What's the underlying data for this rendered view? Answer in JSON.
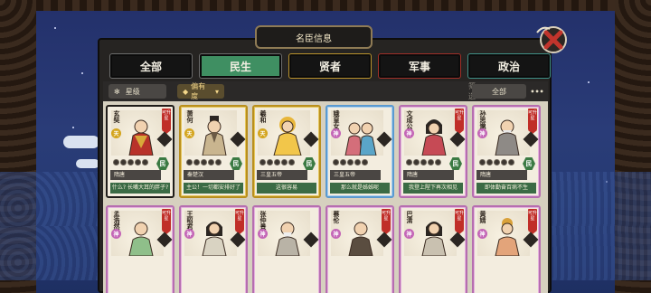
{
  "header": {
    "title": "名臣信息"
  },
  "tabs": [
    {
      "label": "全部"
    },
    {
      "label": "民生"
    },
    {
      "label": "贤者"
    },
    {
      "label": "军事"
    },
    {
      "label": "政治"
    }
  ],
  "filters": {
    "sort_label": "星级",
    "favor_label": "偏有度",
    "filter_label": "筛选:",
    "filter_value": "全部",
    "more": "•••"
  },
  "cards_row1": [
    {
      "name": "玄奘",
      "badge": "天",
      "ribbon": "可升星",
      "dynasty": "隋唐",
      "skill": "什么? 长嘴大耳的胖子?",
      "type": "民",
      "frame": "red"
    },
    {
      "name": "萧何",
      "badge": "天",
      "ribbon": "",
      "dynasty": "秦楚汉",
      "skill": "主公！一切都安排好了",
      "type": "民",
      "frame": "gold"
    },
    {
      "name": "羲和",
      "badge": "天",
      "ribbon": "",
      "dynasty": "三皇五帝",
      "skill": "这很容易",
      "type": "民",
      "frame": "gold"
    },
    {
      "name": "娥皇女英",
      "badge": "神",
      "ribbon": "",
      "dynasty": "三皇五帝",
      "skill": "那么就是姊姊呢",
      "type": "民",
      "frame": "blue"
    },
    {
      "name": "文成公主",
      "badge": "神",
      "ribbon": "可升星",
      "dynasty": "隋唐",
      "skill": "我登上陛下再次相见",
      "type": "民",
      "frame": "pink"
    },
    {
      "name": "孙思邈",
      "badge": "神",
      "ribbon": "可升星",
      "dynasty": "隋唐",
      "skill": "即体勤奋百病不生",
      "type": "民",
      "frame": "pink"
    }
  ],
  "cards_row2": [
    {
      "name": "孟浩然",
      "badge": "神",
      "ribbon": "可升星",
      "frame": "pink"
    },
    {
      "name": "王昭君",
      "badge": "神",
      "ribbon": "可升星",
      "frame": "pink"
    },
    {
      "name": "张仲景",
      "badge": "神",
      "ribbon": "",
      "frame": "pink"
    },
    {
      "name": "蔡伦",
      "badge": "神",
      "ribbon": "可升星",
      "frame": "pink"
    },
    {
      "name": "巴清",
      "badge": "神",
      "ribbon": "可升星",
      "frame": "pink"
    },
    {
      "name": "黄婧",
      "badge": "神",
      "ribbon": "可升星",
      "frame": "pink"
    }
  ]
}
